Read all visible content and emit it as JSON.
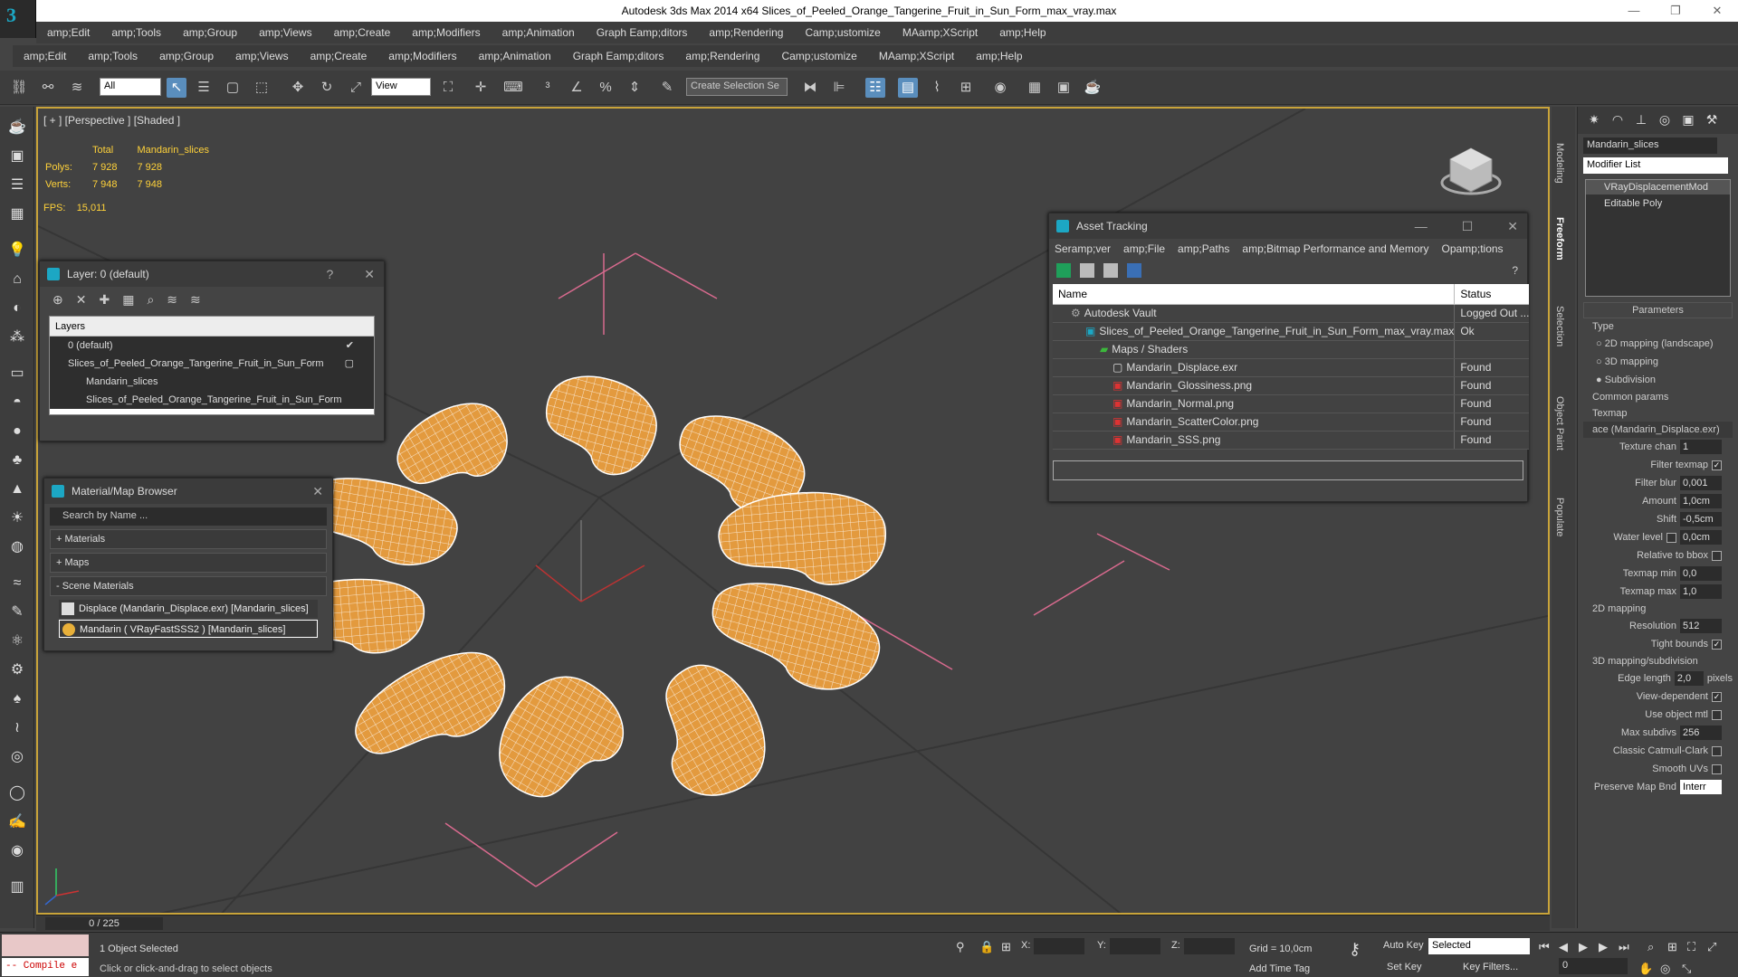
{
  "window": {
    "title": "Autodesk 3ds Max  2014 x64     Slices_of_Peeled_Orange_Tangerine_Fruit_in_Sun_Form_max_vray.max",
    "controls": [
      "—",
      "❐",
      "✕"
    ]
  },
  "menu_top": [
    "amp;Edit",
    "amp;Tools",
    "amp;Group",
    "amp;Views",
    "amp;Create",
    "amp;Modifiers",
    "amp;Animation",
    "Graph Eamp;ditors",
    "amp;Rendering",
    "Camp;ustomize",
    "MAamp;XScript",
    "amp;Help"
  ],
  "menu_second": [
    "amp;Edit",
    "amp;Tools",
    "amp;Group",
    "amp;Views",
    "amp;Create",
    "amp;Modifiers",
    "amp;Animation",
    "Graph Eamp;ditors",
    "amp;Rendering",
    "Camp;ustomize",
    "MAamp;XScript",
    "amp;Help"
  ],
  "toolbar": {
    "filter_value": "All",
    "refcoord_value": "View",
    "selection_set_placeholder": "Create Selection Se"
  },
  "viewport": {
    "label": "[ + ] [Perspective ] [Shaded ]",
    "stats": {
      "col_total": "Total",
      "col_object": "Mandarin_slices",
      "polys_label": "Polys:",
      "polys_total": "7 928",
      "polys_obj": "7 928",
      "verts_label": "Verts:",
      "verts_total": "7 948",
      "verts_obj": "7 948",
      "fps_label": "FPS:",
      "fps_value": "15,011"
    },
    "colors": {
      "slice_fill": "#e39a3e",
      "slice_wire": "#ffffff",
      "grid_pink": "#d86a8e"
    }
  },
  "layer_panel": {
    "title": "Layer: 0 (default)",
    "help": "?",
    "column": "Layers",
    "rows": [
      "0 (default)",
      "Slices_of_Peeled_Orange_Tangerine_Fruit_in_Sun_Form",
      "Mandarin_slices",
      "Slices_of_Peeled_Orange_Tangerine_Fruit_in_Sun_Form"
    ],
    "check": "✔"
  },
  "material_browser": {
    "title": "Material/Map Browser",
    "search_placeholder": "Search by Name ...",
    "sections": [
      "+ Materials",
      "+ Maps",
      "- Scene Materials"
    ],
    "materials": [
      "Displace (Mandarin_Displace.exr) [Mandarin_slices]",
      "Mandarin  ( VRayFastSSS2 )  [Mandarin_slices]"
    ]
  },
  "asset_tracking": {
    "title": "Asset Tracking",
    "menu": [
      "Seramp;ver",
      "amp;File",
      "amp;Paths",
      "amp;Bitmap Performance and Memory",
      "Opamp;tions"
    ],
    "col_name": "Name",
    "col_status": "Status",
    "rows": [
      {
        "name": "Autodesk Vault",
        "status": "Logged Out ..."
      },
      {
        "name": "Slices_of_Peeled_Orange_Tangerine_Fruit_in_Sun_Form_max_vray.max",
        "status": "Ok"
      },
      {
        "name": "Maps / Shaders",
        "status": ""
      },
      {
        "name": "Mandarin_Displace.exr",
        "status": "Found"
      },
      {
        "name": "Mandarin_Glossiness.png",
        "status": "Found"
      },
      {
        "name": "Mandarin_Normal.png",
        "status": "Found"
      },
      {
        "name": "Mandarin_ScatterColor.png",
        "status": "Found"
      },
      {
        "name": "Mandarin_SSS.png",
        "status": "Found"
      }
    ]
  },
  "command_panel": {
    "object_name": "Mandarin_slices",
    "modifier_list": "Modifier List",
    "stack": [
      "VRayDisplacementMod",
      "Editable Poly"
    ],
    "params_title": "Parameters",
    "type_label": "Type",
    "type_options": [
      "2D mapping (landscape)",
      "3D mapping",
      "Subdivision"
    ],
    "common_label": "Common params",
    "texmap_label": "Texmap",
    "texmap_value": "ace (Mandarin_Displace.exr)",
    "texture_chan_label": "Texture chan",
    "texture_chan_value": "1",
    "filter_texmap_label": "Filter texmap",
    "filter_blur_label": "Filter blur",
    "filter_blur_value": "0,001",
    "amount_label": "Amount",
    "amount_value": "1,0cm",
    "shift_label": "Shift",
    "shift_value": "-0,5cm",
    "water_label": "Water level",
    "water_value": "0,0cm",
    "relative_label": "Relative to bbox",
    "texmap_min_label": "Texmap min",
    "texmap_min_value": "0,0",
    "texmap_max_label": "Texmap max",
    "texmap_max_value": "1,0",
    "map2d_label": "2D mapping",
    "resolution_label": "Resolution",
    "resolution_value": "512",
    "tight_label": "Tight bounds",
    "map3d_label": "3D mapping/subdivision",
    "edge_label": "Edge length",
    "edge_value": "2,0",
    "pixels_label": "pixels",
    "viewdep_label": "View-dependent",
    "useobj_label": "Use object mtl",
    "maxsub_label": "Max subdivs",
    "maxsub_value": "256",
    "catmull_label": "Classic Catmull-Clark",
    "smooth_label": "Smooth UVs",
    "preserve_label": "Preserve Map Bnd",
    "preserve_value": "Interr"
  },
  "side_tabs": [
    "Modeling",
    "Freeform",
    "Selection",
    "Object Paint",
    "Populate"
  ],
  "timeline": {
    "frame": "0 / 225"
  },
  "status_bar": {
    "maxscript": "-- Compile e",
    "selected": "1 Object Selected",
    "prompt": "Click or click-and-drag to select objects",
    "x_label": "X:",
    "y_label": "Y:",
    "z_label": "Z:",
    "grid": "Grid = 10,0cm",
    "add_time_tag": "Add Time Tag",
    "auto_key": "Auto Key",
    "set_key": "Set Key",
    "selected_dropdown": "Selected",
    "key_filters": "Key Filters...",
    "frame_value": "0"
  }
}
